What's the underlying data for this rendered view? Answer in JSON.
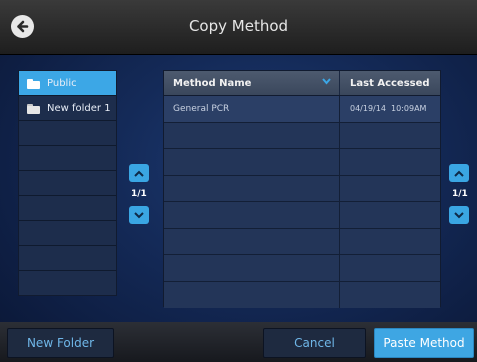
{
  "header": {
    "title": "Copy Method"
  },
  "folders": {
    "items": [
      {
        "label": "Public",
        "selected": true
      },
      {
        "label": "New folder 1",
        "selected": false
      }
    ],
    "page_indicator": "1/1"
  },
  "methods": {
    "columns": {
      "name": "Method Name",
      "accessed": "Last Accessed"
    },
    "rows": [
      {
        "name": "General PCR",
        "accessed": "04/19/14  10:09AM"
      }
    ],
    "page_indicator": "1/1"
  },
  "footer": {
    "new_folder": "New Folder",
    "cancel": "Cancel",
    "paste": "Paste Method"
  },
  "colors": {
    "accent": "#3ca7e6",
    "background": "#142a58"
  }
}
